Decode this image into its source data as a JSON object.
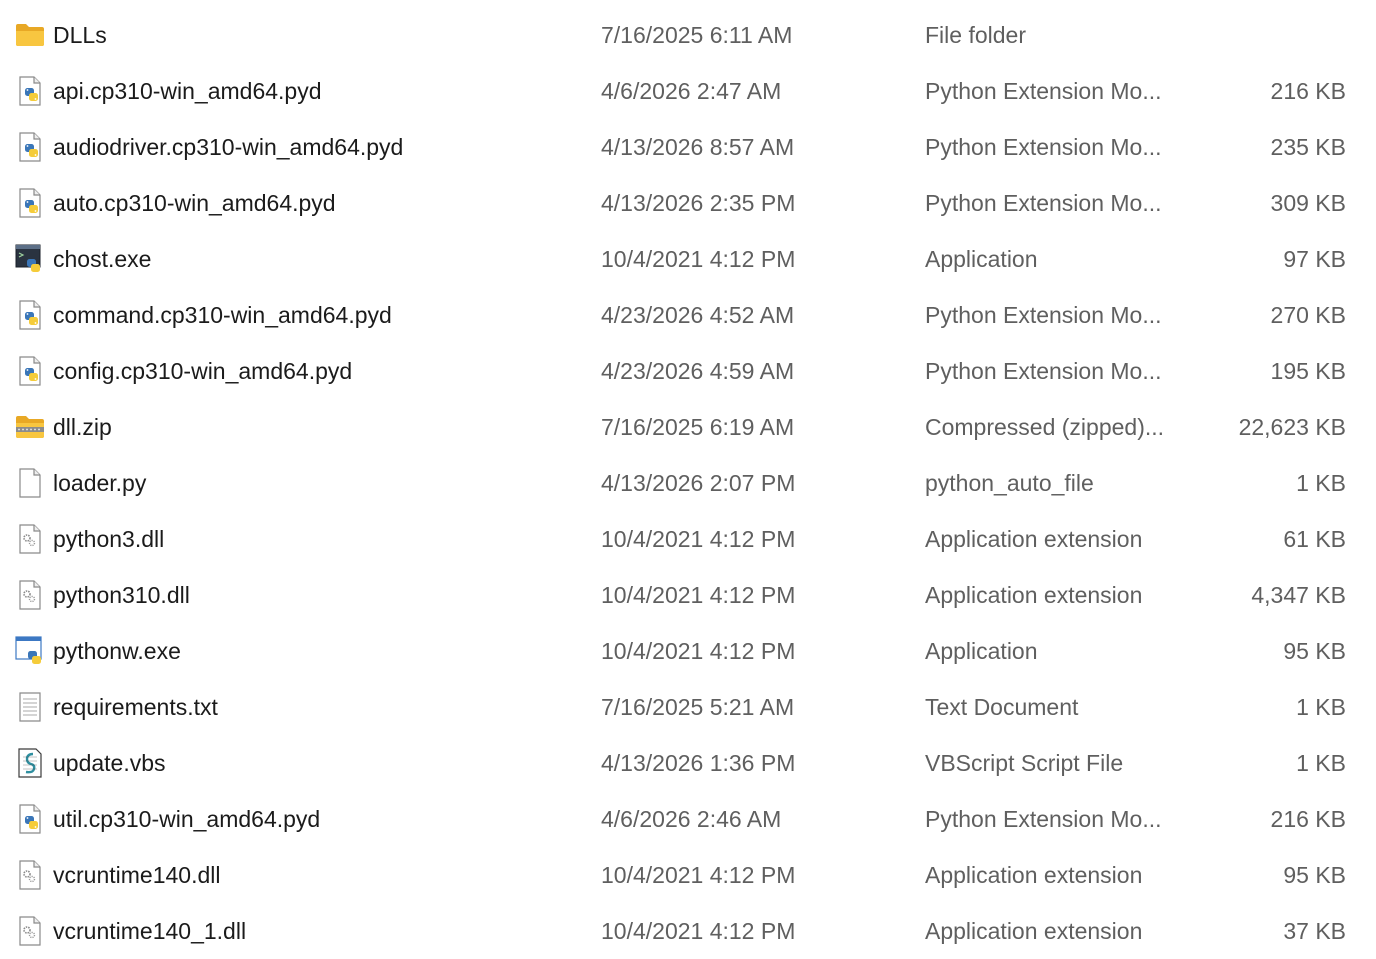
{
  "colors": {
    "name_text": "#1b1b1b",
    "detail_text": "#5f5f5f",
    "folder_yellow": "#f8c640",
    "python_blue": "#3a76b8",
    "python_yellow": "#f5cc3a"
  },
  "files": [
    {
      "name": "DLLs",
      "date": "7/16/2025 6:11 AM",
      "type": "File folder",
      "size": "",
      "icon": "folder-icon"
    },
    {
      "name": "api.cp310-win_amd64.pyd",
      "date": "4/6/2026 2:47 AM",
      "type": "Python Extension Mo...",
      "size": "216 KB",
      "icon": "python-file-icon"
    },
    {
      "name": "audiodriver.cp310-win_amd64.pyd",
      "date": "4/13/2026 8:57 AM",
      "type": "Python Extension Mo...",
      "size": "235 KB",
      "icon": "python-file-icon"
    },
    {
      "name": "auto.cp310-win_amd64.pyd",
      "date": "4/13/2026 2:35 PM",
      "type": "Python Extension Mo...",
      "size": "309 KB",
      "icon": "python-file-icon"
    },
    {
      "name": "chost.exe",
      "date": "10/4/2021 4:12 PM",
      "type": "Application",
      "size": "97 KB",
      "icon": "console-app-icon"
    },
    {
      "name": "command.cp310-win_amd64.pyd",
      "date": "4/23/2026 4:52 AM",
      "type": "Python Extension Mo...",
      "size": "270 KB",
      "icon": "python-file-icon"
    },
    {
      "name": "config.cp310-win_amd64.pyd",
      "date": "4/23/2026 4:59 AM",
      "type": "Python Extension Mo...",
      "size": "195 KB",
      "icon": "python-file-icon"
    },
    {
      "name": "dll.zip",
      "date": "7/16/2025 6:19 AM",
      "type": "Compressed (zipped)...",
      "size": "22,623 KB",
      "icon": "zip-folder-icon"
    },
    {
      "name": "loader.py",
      "date": "4/13/2026 2:07 PM",
      "type": "python_auto_file",
      "size": "1 KB",
      "icon": "blank-file-icon"
    },
    {
      "name": "python3.dll",
      "date": "10/4/2021 4:12 PM",
      "type": "Application extension",
      "size": "61 KB",
      "icon": "dll-file-icon"
    },
    {
      "name": "python310.dll",
      "date": "10/4/2021 4:12 PM",
      "type": "Application extension",
      "size": "4,347 KB",
      "icon": "dll-file-icon"
    },
    {
      "name": "pythonw.exe",
      "date": "10/4/2021 4:12 PM",
      "type": "Application",
      "size": "95 KB",
      "icon": "window-app-icon"
    },
    {
      "name": "requirements.txt",
      "date": "7/16/2025 5:21 AM",
      "type": "Text Document",
      "size": "1 KB",
      "icon": "text-file-icon"
    },
    {
      "name": "update.vbs",
      "date": "4/13/2026 1:36 PM",
      "type": "VBScript Script File",
      "size": "1 KB",
      "icon": "script-file-icon"
    },
    {
      "name": "util.cp310-win_amd64.pyd",
      "date": "4/6/2026 2:46 AM",
      "type": "Python Extension Mo...",
      "size": "216 KB",
      "icon": "python-file-icon"
    },
    {
      "name": "vcruntime140.dll",
      "date": "10/4/2021 4:12 PM",
      "type": "Application extension",
      "size": "95 KB",
      "icon": "dll-file-icon"
    },
    {
      "name": "vcruntime140_1.dll",
      "date": "10/4/2021 4:12 PM",
      "type": "Application extension",
      "size": "37 KB",
      "icon": "dll-file-icon"
    }
  ]
}
